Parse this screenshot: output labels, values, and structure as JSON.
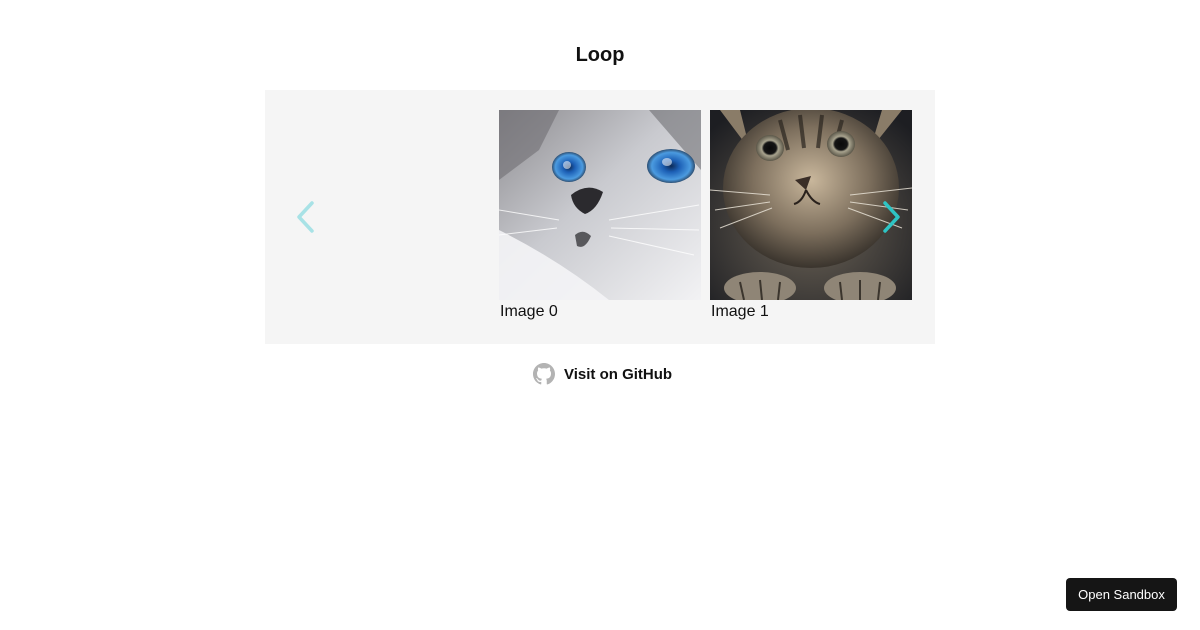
{
  "page": {
    "title": "Loop"
  },
  "carousel": {
    "prev_icon": "chevron-left-icon",
    "next_icon": "chevron-right-icon",
    "slides": [
      {
        "caption": "Image 0",
        "image": "white-kitten-blue-eyes-photo"
      },
      {
        "caption": "Image 1",
        "image": "tabby-kitten-photo"
      }
    ]
  },
  "github": {
    "icon": "github-icon",
    "label": "Visit on GitHub"
  },
  "sandbox": {
    "label": "Open Sandbox"
  },
  "colors": {
    "carousel_background": "#f5f5f5",
    "arrow_inactive": "#a8e2e6",
    "arrow_active": "#2ec4c4",
    "button_background": "#151515"
  }
}
